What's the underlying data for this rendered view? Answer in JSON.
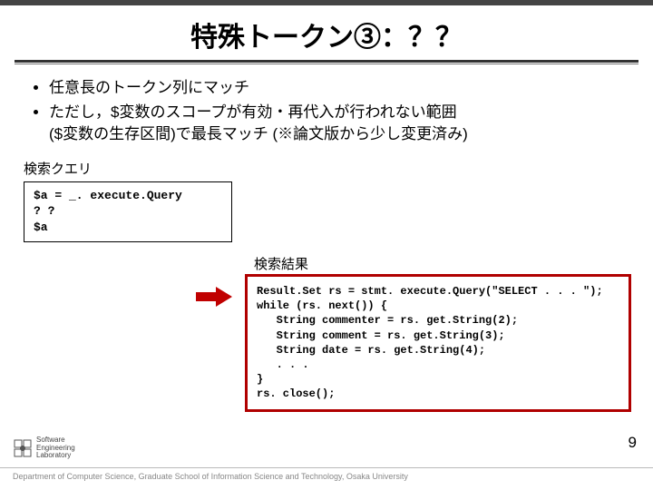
{
  "title": "特殊トークン③：？？",
  "bullets": {
    "b1": "任意長のトークン列にマッチ",
    "b2": "ただし，$変数のスコープが有効・再代入が行われない範囲",
    "b2_cont": "($変数の生存区間)で最長マッチ (※論文版から少し変更済み)"
  },
  "labels": {
    "query": "検索クエリ",
    "result": "検索結果"
  },
  "query_code": "$a = _. execute.Query\n? ?\n$a",
  "result_code": "Result.Set rs = stmt. execute.Query(\"SELECT . . . \");\nwhile (rs. next()) {\n   String commenter = rs. get.String(2);\n   String comment = rs. get.String(3);\n   String date = rs. get.String(4);\n   . . .\n}\nrs. close();",
  "slide_number": "9",
  "logo": {
    "line1": "Software",
    "line2": "Engineering",
    "line3": "Laboratory"
  },
  "footer": "Department of Computer Science, Graduate School of Information Science and Technology, Osaka University"
}
